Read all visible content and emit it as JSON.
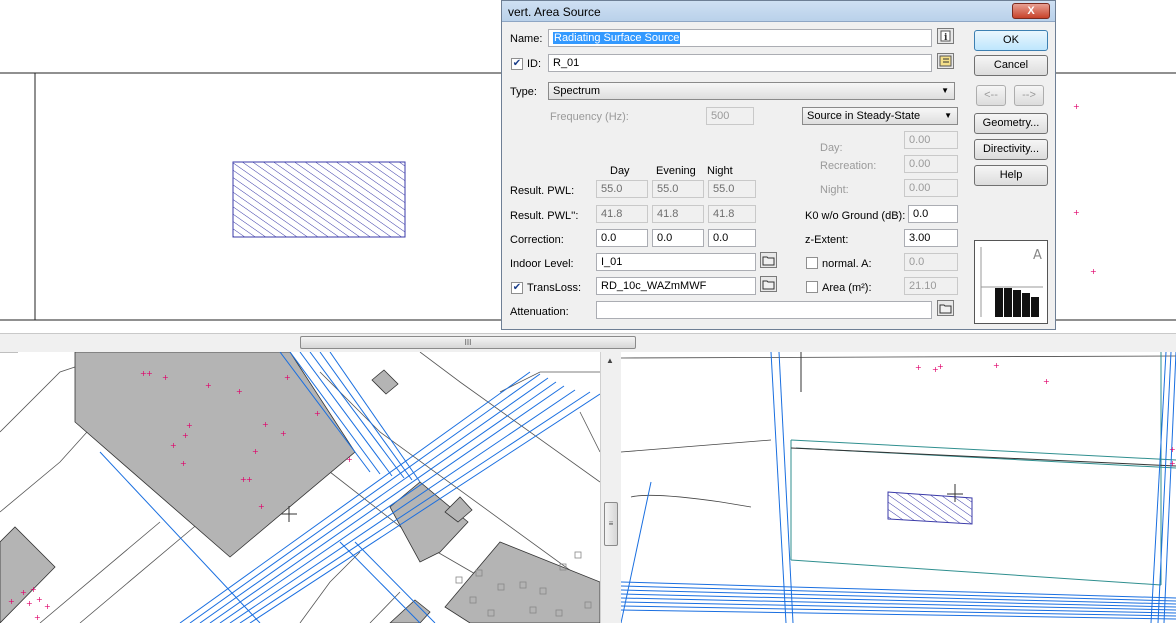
{
  "dialog": {
    "title": "vert. Area Source",
    "close_label": "X",
    "name_label": "Name:",
    "name_value": "Radiating Surface Source",
    "id_label": "ID:",
    "id_checked": true,
    "id_value": "R_01",
    "type_label": "Type:",
    "type_value": "Spectrum",
    "frequency_label": "Frequency (Hz):",
    "frequency_value": "500",
    "mode_value": "Source in Steady-State",
    "day_label": "Day:",
    "day_value": "0.00",
    "recreation_label": "Recreation:",
    "recreation_value": "0.00",
    "night_label": "Night:",
    "night_value": "0.00",
    "col_day": "Day",
    "col_evening": "Evening",
    "col_night": "Night",
    "pwl_label": "Result. PWL:",
    "pwl_values": [
      "55.0",
      "55.0",
      "55.0"
    ],
    "pwl2_label": "Result. PWL'':",
    "pwl2_values": [
      "41.8",
      "41.8",
      "41.8"
    ],
    "correction_label": "Correction:",
    "correction_values": [
      "0.0",
      "0.0",
      "0.0"
    ],
    "k0_label": "K0 w/o Ground (dB):",
    "k0_value": "0.0",
    "zextent_label": "z-Extent:",
    "zextent_value": "3.00",
    "indoor_label": "Indoor Level:",
    "indoor_value": "I_01",
    "normal_label": "normal. A:",
    "normal_checked": false,
    "normal_value": "0.0",
    "transloss_label": "TransLoss:",
    "transloss_checked": true,
    "transloss_value": "RD_10c_WAZmMWF",
    "area_label": "Area (m²):",
    "area_checked": false,
    "area_value": "21.10",
    "attenuation_label": "Attenuation:",
    "attenuation_value": "",
    "buttons": {
      "ok": "OK",
      "cancel": "Cancel",
      "prev": "<--",
      "next": "-->",
      "geometry": "Geometry...",
      "directivity": "Directivity...",
      "help": "Help"
    },
    "spectrum_preview": {
      "weighting_label": "A",
      "bar_levels": [
        0.95,
        0.95,
        0.9,
        0.8,
        0.65
      ]
    }
  },
  "scroll": {
    "h_thumb_glyph": "III",
    "v_thumb_glyph": "≡",
    "up_arrow": "▲"
  },
  "colors": {
    "hatch": "#3a3aa8",
    "lines": "#1a6fe0",
    "points": "#e0006a",
    "building": "#b4b4b4"
  }
}
